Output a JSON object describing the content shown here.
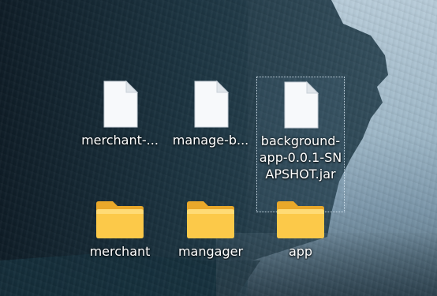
{
  "desktop": {
    "icons": [
      {
        "label": "merchant-...",
        "type": "file",
        "icon": "file-icon"
      },
      {
        "label": "manage-b...",
        "type": "file",
        "icon": "file-icon"
      },
      {
        "label": "background-app-0.0.1-SNAPSHOT.jar",
        "type": "file",
        "icon": "file-icon",
        "selected": true
      },
      {
        "label": "merchant",
        "type": "folder",
        "icon": "folder-icon"
      },
      {
        "label": "mangager",
        "type": "folder",
        "icon": "folder-icon"
      },
      {
        "label": "app",
        "type": "folder",
        "icon": "folder-icon"
      }
    ]
  }
}
